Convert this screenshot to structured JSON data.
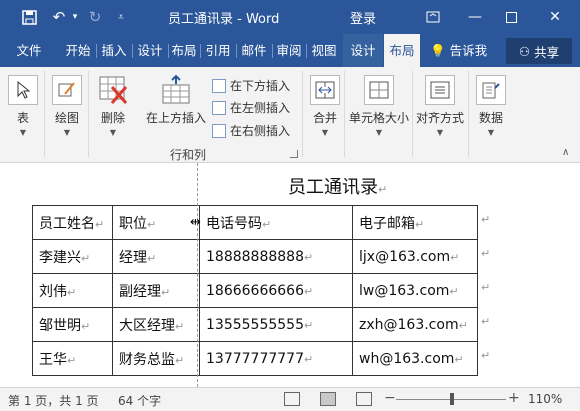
{
  "titlebar": {
    "title": "员工通讯录 - Word",
    "login": "登录",
    "save_icon": "save-icon",
    "undo_icon": "undo-icon",
    "redo_icon": "redo-icon",
    "customize_icon": "customize-qat-icon"
  },
  "tabs": [
    {
      "label": "文件"
    },
    {
      "label": "开始"
    },
    {
      "label": "插入"
    },
    {
      "label": "设计"
    },
    {
      "label": "布局"
    },
    {
      "label": "引用"
    },
    {
      "label": "邮件"
    },
    {
      "label": "审阅"
    },
    {
      "label": "视图"
    },
    {
      "label": "设计"
    },
    {
      "label": "布局"
    }
  ],
  "tell_me": "告诉我",
  "share": "共享",
  "ribbon": {
    "table": "表",
    "draw": "绘图",
    "delete": "删除",
    "insert_above": "在上方插入",
    "insert_below": "在下方插入",
    "insert_left": "在左侧插入",
    "insert_right": "在右侧插入",
    "group_rows_cols": "行和列",
    "merge": "合并",
    "cell_size": "单元格大小",
    "alignment": "对齐方式",
    "data": "数据"
  },
  "document": {
    "title": "员工通讯录",
    "mark": "↵",
    "table": {
      "header": [
        "员工姓名",
        "职位",
        "电话号码",
        "电子邮箱"
      ],
      "rows": [
        [
          "李建兴",
          "经理",
          "18888888888",
          "ljx@163.com"
        ],
        [
          "刘伟",
          "副经理",
          "18666666666",
          "lw@163.com"
        ],
        [
          "邹世明",
          "大区经理",
          "13555555555",
          "zxh@163.com"
        ],
        [
          "王华",
          "财务总监",
          "13777777777",
          "wh@163.com"
        ]
      ]
    }
  },
  "statusbar": {
    "page": "第 1 页，共 1 页",
    "words": "64 个字",
    "zoom": "110%"
  }
}
